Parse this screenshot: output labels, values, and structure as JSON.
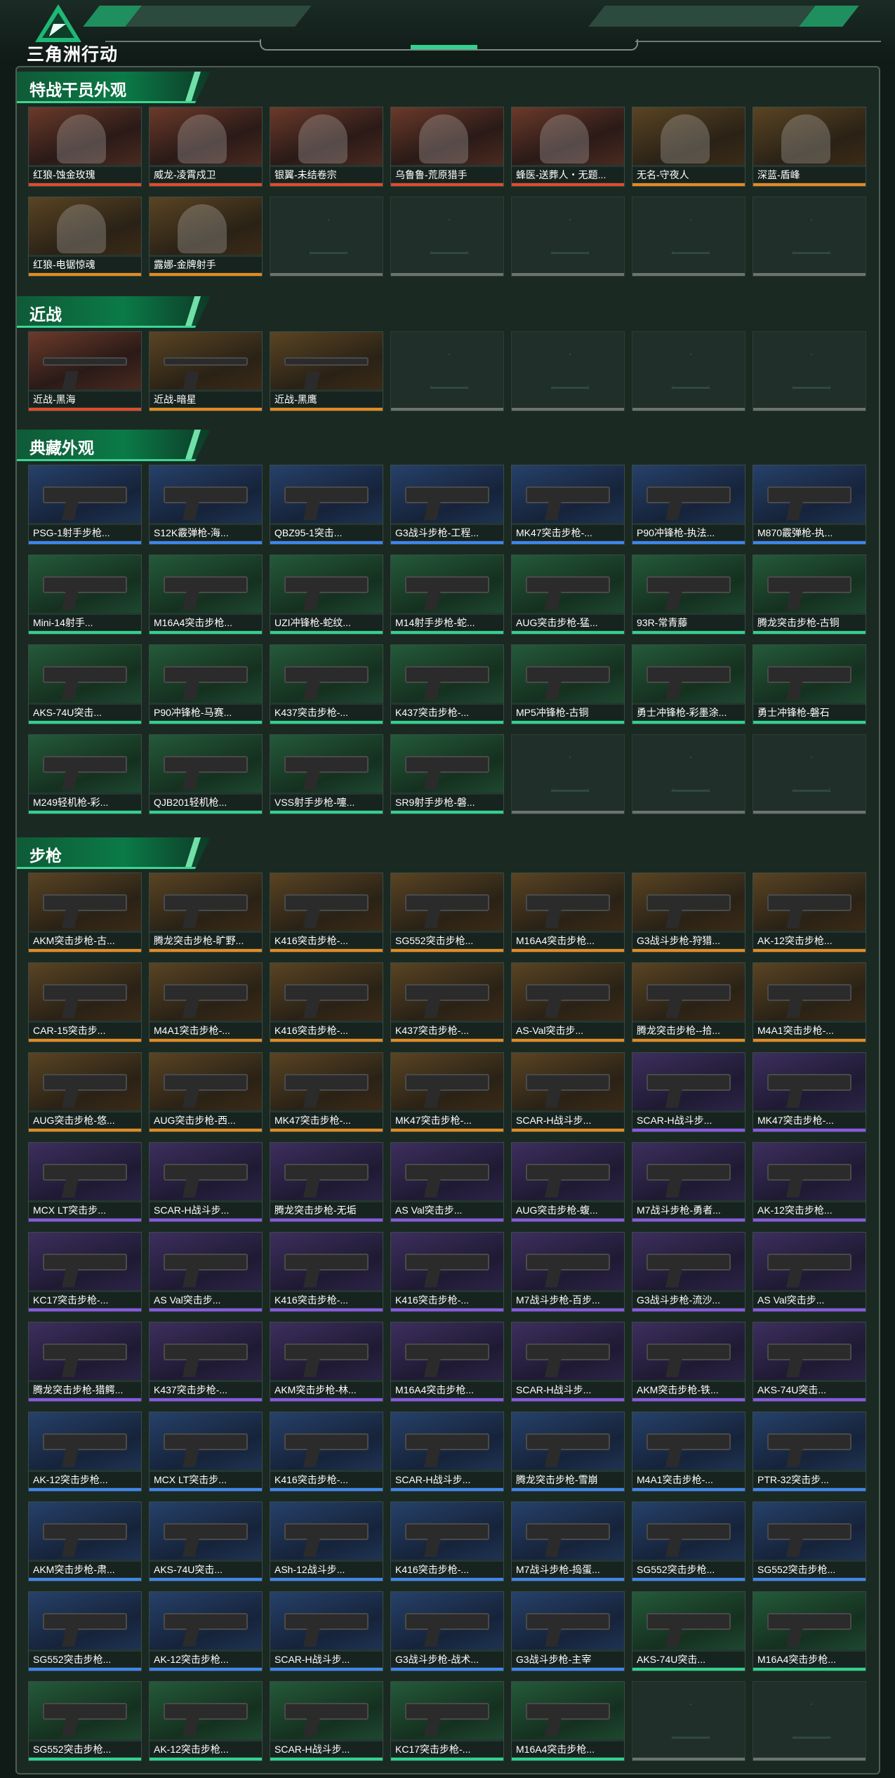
{
  "header": {
    "brand": "三角洲行动",
    "accent": "#2fd38f"
  },
  "sections": [
    {
      "title": "特战干员外观",
      "kind": "operator",
      "cols": 7,
      "items": [
        {
          "label": "红狼-蚀金玫瑰",
          "rarity": "red"
        },
        {
          "label": "威龙-凌霄戍卫",
          "rarity": "red"
        },
        {
          "label": "银翼-未结卷宗",
          "rarity": "red"
        },
        {
          "label": "乌鲁鲁-荒原猎手",
          "rarity": "red"
        },
        {
          "label": "蜂医-送葬人・无题...",
          "rarity": "red"
        },
        {
          "label": "无名-守夜人",
          "rarity": "gold"
        },
        {
          "label": "深蓝-盾峰",
          "rarity": "gold"
        },
        {
          "label": "红狼-电锯惊魂",
          "rarity": "gold"
        },
        {
          "label": "露娜-金牌射手",
          "rarity": "gold"
        }
      ],
      "empty": 5
    },
    {
      "title": "近战",
      "kind": "melee",
      "cols": 7,
      "items": [
        {
          "label": "近战-黑海",
          "rarity": "red"
        },
        {
          "label": "近战-暗星",
          "rarity": "gold"
        },
        {
          "label": "近战-黑鹰",
          "rarity": "gold"
        }
      ],
      "empty": 4
    },
    {
      "title": "典藏外观",
      "kind": "weapon",
      "cols": 7,
      "items": [
        {
          "label": "PSG-1射手步枪...",
          "rarity": "blue"
        },
        {
          "label": "S12K霰弹枪-海...",
          "rarity": "blue"
        },
        {
          "label": "QBZ95-1突击...",
          "rarity": "blue"
        },
        {
          "label": "G3战斗步枪-工程...",
          "rarity": "blue"
        },
        {
          "label": "MK47突击步枪-...",
          "rarity": "blue"
        },
        {
          "label": "P90冲锋枪-执法...",
          "rarity": "blue"
        },
        {
          "label": "M870霰弹枪-执...",
          "rarity": "blue"
        },
        {
          "label": "Mini-14射手...",
          "rarity": "green"
        },
        {
          "label": "M16A4突击步枪...",
          "rarity": "green"
        },
        {
          "label": "UZI冲锋枪-蛇纹...",
          "rarity": "green"
        },
        {
          "label": "M14射手步枪-蛇...",
          "rarity": "green"
        },
        {
          "label": "AUG突击步枪-猛...",
          "rarity": "green"
        },
        {
          "label": "93R-常青藤",
          "rarity": "green"
        },
        {
          "label": "腾龙突击步枪-古铜",
          "rarity": "green"
        },
        {
          "label": "AKS-74U突击...",
          "rarity": "green"
        },
        {
          "label": "P90冲锋枪-马赛...",
          "rarity": "green"
        },
        {
          "label": "K437突击步枪-...",
          "rarity": "green"
        },
        {
          "label": "K437突击步枪-...",
          "rarity": "green"
        },
        {
          "label": "MP5冲锋枪-古铜",
          "rarity": "green"
        },
        {
          "label": "勇士冲锋枪-彩墨涂...",
          "rarity": "green"
        },
        {
          "label": "勇士冲锋枪-磐石",
          "rarity": "green"
        },
        {
          "label": "M249轻机枪-彩...",
          "rarity": "green"
        },
        {
          "label": "QJB201轻机枪...",
          "rarity": "green"
        },
        {
          "label": "VSS射手步枪-嚏...",
          "rarity": "green"
        },
        {
          "label": "SR9射手步枪-磐...",
          "rarity": "green"
        }
      ],
      "empty": 3
    },
    {
      "title": "步枪",
      "kind": "weapon",
      "cols": 7,
      "items": [
        {
          "label": "AKM突击步枪-古...",
          "rarity": "gold"
        },
        {
          "label": "腾龙突击步枪-旷野...",
          "rarity": "gold"
        },
        {
          "label": "K416突击步枪-...",
          "rarity": "gold"
        },
        {
          "label": "SG552突击步枪...",
          "rarity": "gold"
        },
        {
          "label": "M16A4突击步枪...",
          "rarity": "gold"
        },
        {
          "label": "G3战斗步枪-狩猎...",
          "rarity": "gold"
        },
        {
          "label": "AK-12突击步枪...",
          "rarity": "gold"
        },
        {
          "label": "CAR-15突击步...",
          "rarity": "gold"
        },
        {
          "label": "M4A1突击步枪-...",
          "rarity": "gold"
        },
        {
          "label": "K416突击步枪-...",
          "rarity": "gold"
        },
        {
          "label": "K437突击步枪-...",
          "rarity": "gold"
        },
        {
          "label": "AS-Val突击步...",
          "rarity": "gold"
        },
        {
          "label": "腾龙突击步枪--拾...",
          "rarity": "gold"
        },
        {
          "label": "M4A1突击步枪-...",
          "rarity": "gold"
        },
        {
          "label": "AUG突击步枪-悠...",
          "rarity": "gold"
        },
        {
          "label": "AUG突击步枪-西...",
          "rarity": "gold"
        },
        {
          "label": "MK47突击步枪-...",
          "rarity": "gold"
        },
        {
          "label": "MK47突击步枪-...",
          "rarity": "gold"
        },
        {
          "label": "SCAR-H战斗步...",
          "rarity": "gold"
        },
        {
          "label": "SCAR-H战斗步...",
          "rarity": "purple"
        },
        {
          "label": "MK47突击步枪-...",
          "rarity": "purple"
        },
        {
          "label": "MCX LT突击步...",
          "rarity": "purple"
        },
        {
          "label": "SCAR-H战斗步...",
          "rarity": "purple"
        },
        {
          "label": "腾龙突击步枪-无垢",
          "rarity": "purple"
        },
        {
          "label": "AS Val突击步...",
          "rarity": "purple"
        },
        {
          "label": "AUG突击步枪-蝮...",
          "rarity": "purple"
        },
        {
          "label": "M7战斗步枪-勇者...",
          "rarity": "purple"
        },
        {
          "label": "AK-12突击步枪...",
          "rarity": "purple"
        },
        {
          "label": "KC17突击步枪-...",
          "rarity": "purple"
        },
        {
          "label": "AS Val突击步...",
          "rarity": "purple"
        },
        {
          "label": "K416突击步枪-...",
          "rarity": "purple"
        },
        {
          "label": "K416突击步枪-...",
          "rarity": "purple"
        },
        {
          "label": "M7战斗步枪-百步...",
          "rarity": "purple"
        },
        {
          "label": "G3战斗步枪-流沙...",
          "rarity": "purple"
        },
        {
          "label": "AS Val突击步...",
          "rarity": "purple"
        },
        {
          "label": "腾龙突击步枪-猎鳄...",
          "rarity": "purple"
        },
        {
          "label": "K437突击步枪-...",
          "rarity": "purple"
        },
        {
          "label": "AKM突击步枪-林...",
          "rarity": "purple"
        },
        {
          "label": "M16A4突击步枪...",
          "rarity": "purple"
        },
        {
          "label": "SCAR-H战斗步...",
          "rarity": "purple"
        },
        {
          "label": "AKM突击步枪-铁...",
          "rarity": "purple"
        },
        {
          "label": "AKS-74U突击...",
          "rarity": "purple"
        },
        {
          "label": "AK-12突击步枪...",
          "rarity": "blue"
        },
        {
          "label": "MCX LT突击步...",
          "rarity": "blue"
        },
        {
          "label": "K416突击步枪-...",
          "rarity": "blue"
        },
        {
          "label": "SCAR-H战斗步...",
          "rarity": "blue"
        },
        {
          "label": "腾龙突击步枪-雪崩",
          "rarity": "blue"
        },
        {
          "label": "M4A1突击步枪-...",
          "rarity": "blue"
        },
        {
          "label": "PTR-32突击步...",
          "rarity": "blue"
        },
        {
          "label": "AKM突击步枪-肃...",
          "rarity": "blue"
        },
        {
          "label": "AKS-74U突击...",
          "rarity": "blue"
        },
        {
          "label": "ASh-12战斗步...",
          "rarity": "blue"
        },
        {
          "label": "K416突击步枪-...",
          "rarity": "blue"
        },
        {
          "label": "M7战斗步枪-捣蛋...",
          "rarity": "blue"
        },
        {
          "label": "SG552突击步枪...",
          "rarity": "blue"
        },
        {
          "label": "SG552突击步枪...",
          "rarity": "blue"
        },
        {
          "label": "SG552突击步枪...",
          "rarity": "blue"
        },
        {
          "label": "AK-12突击步枪...",
          "rarity": "blue"
        },
        {
          "label": "SCAR-H战斗步...",
          "rarity": "blue"
        },
        {
          "label": "G3战斗步枪-战术...",
          "rarity": "blue"
        },
        {
          "label": "G3战斗步枪-主宰",
          "rarity": "blue"
        },
        {
          "label": "AKS-74U突击...",
          "rarity": "green"
        },
        {
          "label": "M16A4突击步枪...",
          "rarity": "green"
        },
        {
          "label": "SG552突击步枪...",
          "rarity": "green"
        },
        {
          "label": "AK-12突击步枪...",
          "rarity": "green"
        },
        {
          "label": "SCAR-H战斗步...",
          "rarity": "green"
        },
        {
          "label": "KC17突击步枪-...",
          "rarity": "green"
        },
        {
          "label": "M16A4突击步枪...",
          "rarity": "green"
        }
      ],
      "empty": 2
    }
  ]
}
